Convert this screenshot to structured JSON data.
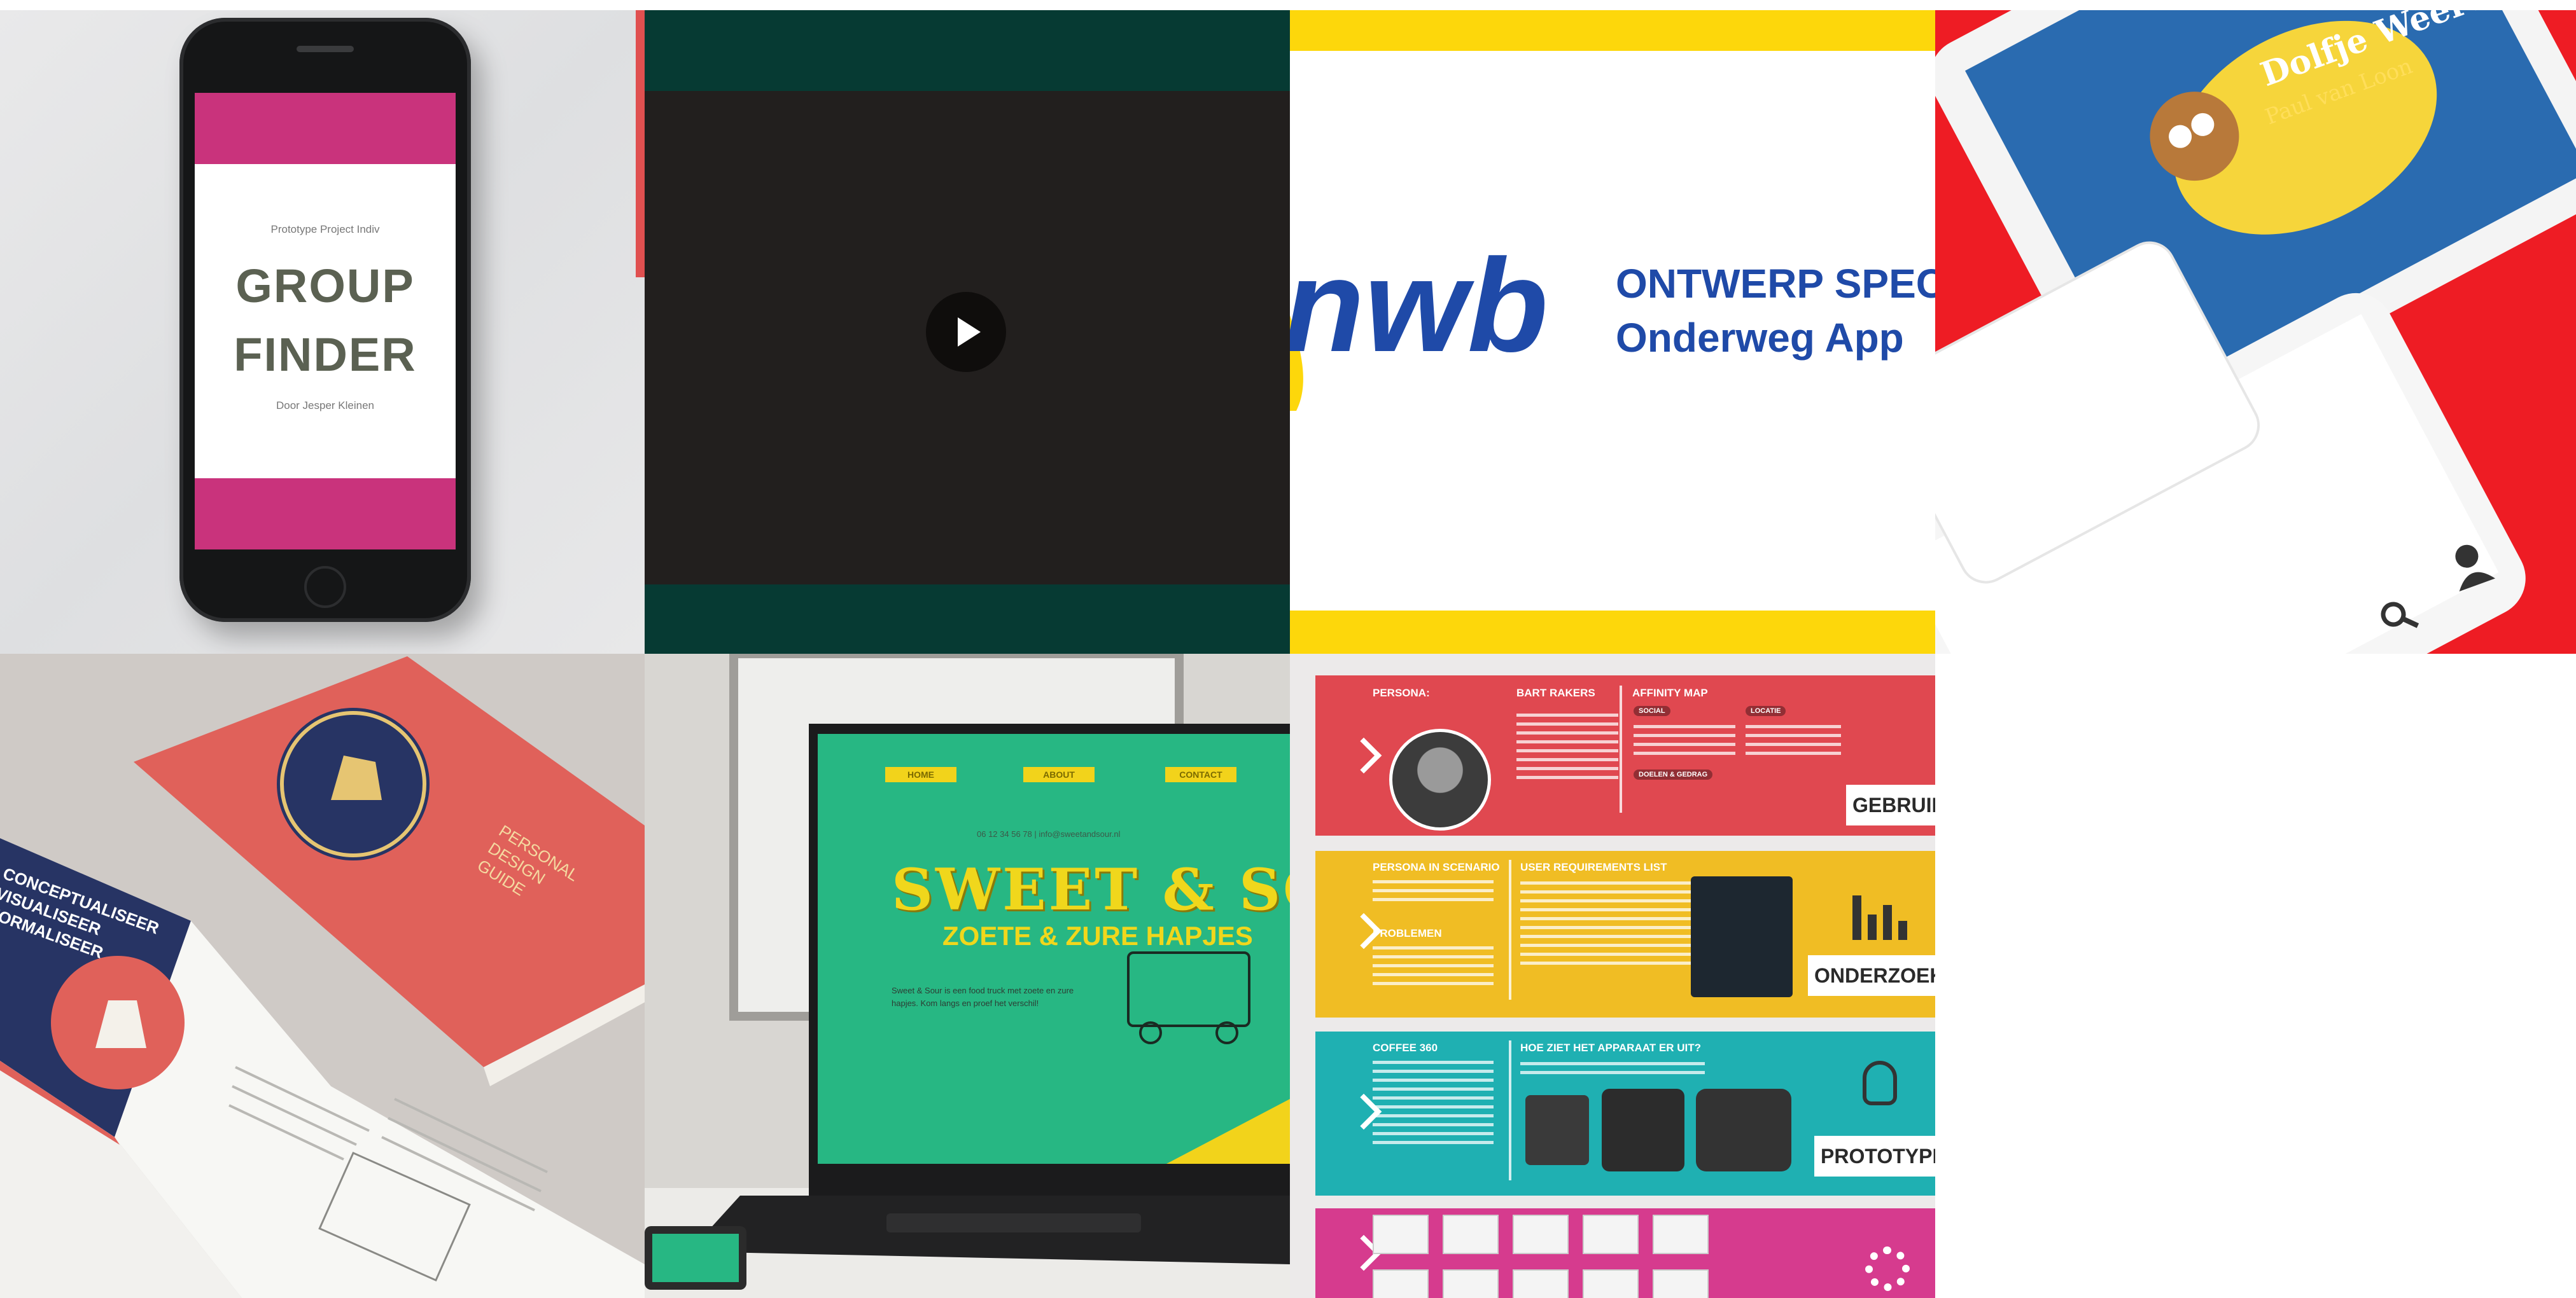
{
  "portfolio": {
    "tiles": [
      {
        "name": "group-finder",
        "screen": {
          "subtitle": "Prototype Project Indiv",
          "title_line1": "GROUP",
          "title_line2": "FINDER",
          "byline": "Door Jesper Kleinen"
        },
        "colors": {
          "accent": "#c9337c",
          "title": "#5b6152"
        }
      },
      {
        "name": "video",
        "colors": {
          "frame": "#063a33",
          "video": "#221f1e"
        },
        "control_icon": "play-icon"
      },
      {
        "name": "anwb",
        "logo_text": "nwb",
        "line1": "ONTWERP SPEC",
        "line2": "Onderweg App",
        "colors": {
          "brand_blue": "#1f4aa8",
          "brand_yellow": "#fdd70b"
        }
      },
      {
        "name": "dolfje-weerwolfje",
        "book_title": "Dolfje Weerwolfje",
        "author": "Paul van Loon",
        "icons": [
          "search-icon",
          "user-icon"
        ],
        "colors": {
          "background": "#ee1c24"
        }
      },
      {
        "name": "personal-design-guide",
        "cover_title_lines": [
          "PERSONAL",
          "DESIGN",
          "GUIDE"
        ],
        "page_lines": [
          "CONCEPTUALISEER",
          "VISUALISEER",
          "FORMALISEER"
        ],
        "colors": {
          "cover": "#e05b55",
          "navy": "#283560"
        }
      },
      {
        "name": "sweet-and-sour",
        "nav": [
          "HOME",
          "ABOUT",
          "CONTACT"
        ],
        "contact_line": "06 12 34 56 78  |  info@sweetandsour.nl",
        "title": "SWEET & SOUR",
        "subtitle": "ZOETE & ZURE HAPJES",
        "body": "Sweet & Sour is een food truck met zoete en zure hapjes. Kom langs en proef het verschil!",
        "colors": {
          "screen": "#27b783",
          "yellow": "#f0d71c"
        }
      },
      {
        "name": "coffee-poster",
        "sections": {
          "persona_label": "PERSONA:",
          "persona_name": "BART RAKERS",
          "affinity": "AFFINITY MAP",
          "pill_social": "SOCIAL",
          "pill_locatie": "LOCATIE",
          "pill_doelen": "DOELEN & GEDRAG",
          "scenario": "PERSONA IN SCENARIO",
          "requirements": "USER REQUIREMENTS LIST",
          "problemen": "PROBLEMEN",
          "coffee": "COFFEE 360",
          "apparaat": "HOE ZIET HET APPARAAT ER UIT?"
        },
        "tags": [
          "GEBRUIKER",
          "ONDERZOEK",
          "PROTOTYPE"
        ],
        "colors": {
          "red": "#e04850",
          "yellow": "#f0bd24",
          "teal": "#1fb0b2",
          "pink": "#d63b8e"
        }
      }
    ]
  }
}
